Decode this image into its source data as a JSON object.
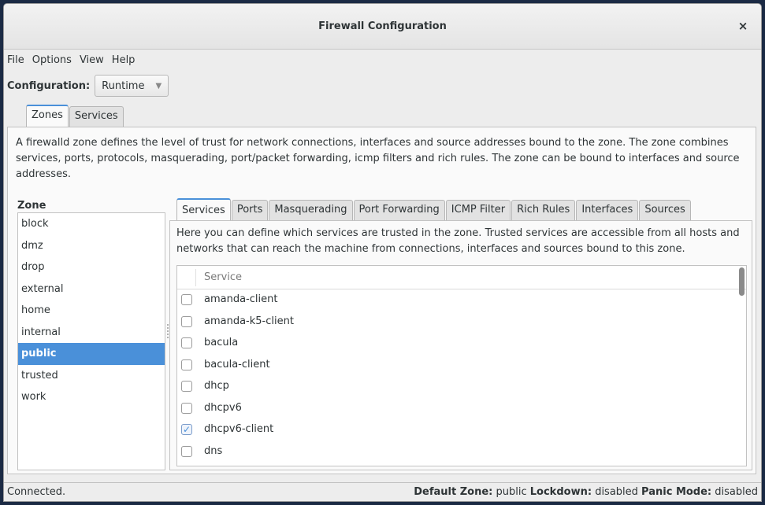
{
  "window": {
    "title": "Firewall Configuration"
  },
  "menu": {
    "items": [
      "File",
      "Options",
      "View",
      "Help"
    ]
  },
  "configuration": {
    "label": "Configuration:",
    "value": "Runtime"
  },
  "top_tabs": [
    "Zones",
    "Services"
  ],
  "zones_description": "A firewalld zone defines the level of trust for network connections, interfaces and source addresses bound to the zone. The zone combines services, ports, protocols, masquerading, port/packet forwarding, icmp filters and rich rules. The zone can be bound to interfaces and source addresses.",
  "zone_list": {
    "label": "Zone",
    "items": [
      "block",
      "dmz",
      "drop",
      "external",
      "home",
      "internal",
      "public",
      "trusted",
      "work"
    ],
    "selected": "public"
  },
  "inner_tabs": [
    "Services",
    "Ports",
    "Masquerading",
    "Port Forwarding",
    "ICMP Filter",
    "Rich Rules",
    "Interfaces",
    "Sources"
  ],
  "services_description": "Here you can define which services are trusted in the zone. Trusted services are accessible from all hosts and networks that can reach the machine from connections, interfaces and sources bound to this zone.",
  "services_table": {
    "column": "Service",
    "rows": [
      {
        "name": "amanda-client",
        "checked": false
      },
      {
        "name": "amanda-k5-client",
        "checked": false
      },
      {
        "name": "bacula",
        "checked": false
      },
      {
        "name": "bacula-client",
        "checked": false
      },
      {
        "name": "dhcp",
        "checked": false
      },
      {
        "name": "dhcpv6",
        "checked": false
      },
      {
        "name": "dhcpv6-client",
        "checked": true
      },
      {
        "name": "dns",
        "checked": false
      }
    ]
  },
  "status": {
    "connection": "Connected.",
    "default_zone_label": "Default Zone:",
    "default_zone": "public",
    "lockdown_label": "Lockdown:",
    "lockdown": "disabled",
    "panic_label": "Panic Mode:",
    "panic": "disabled"
  },
  "colors": {
    "accent": "#4a90d9"
  }
}
